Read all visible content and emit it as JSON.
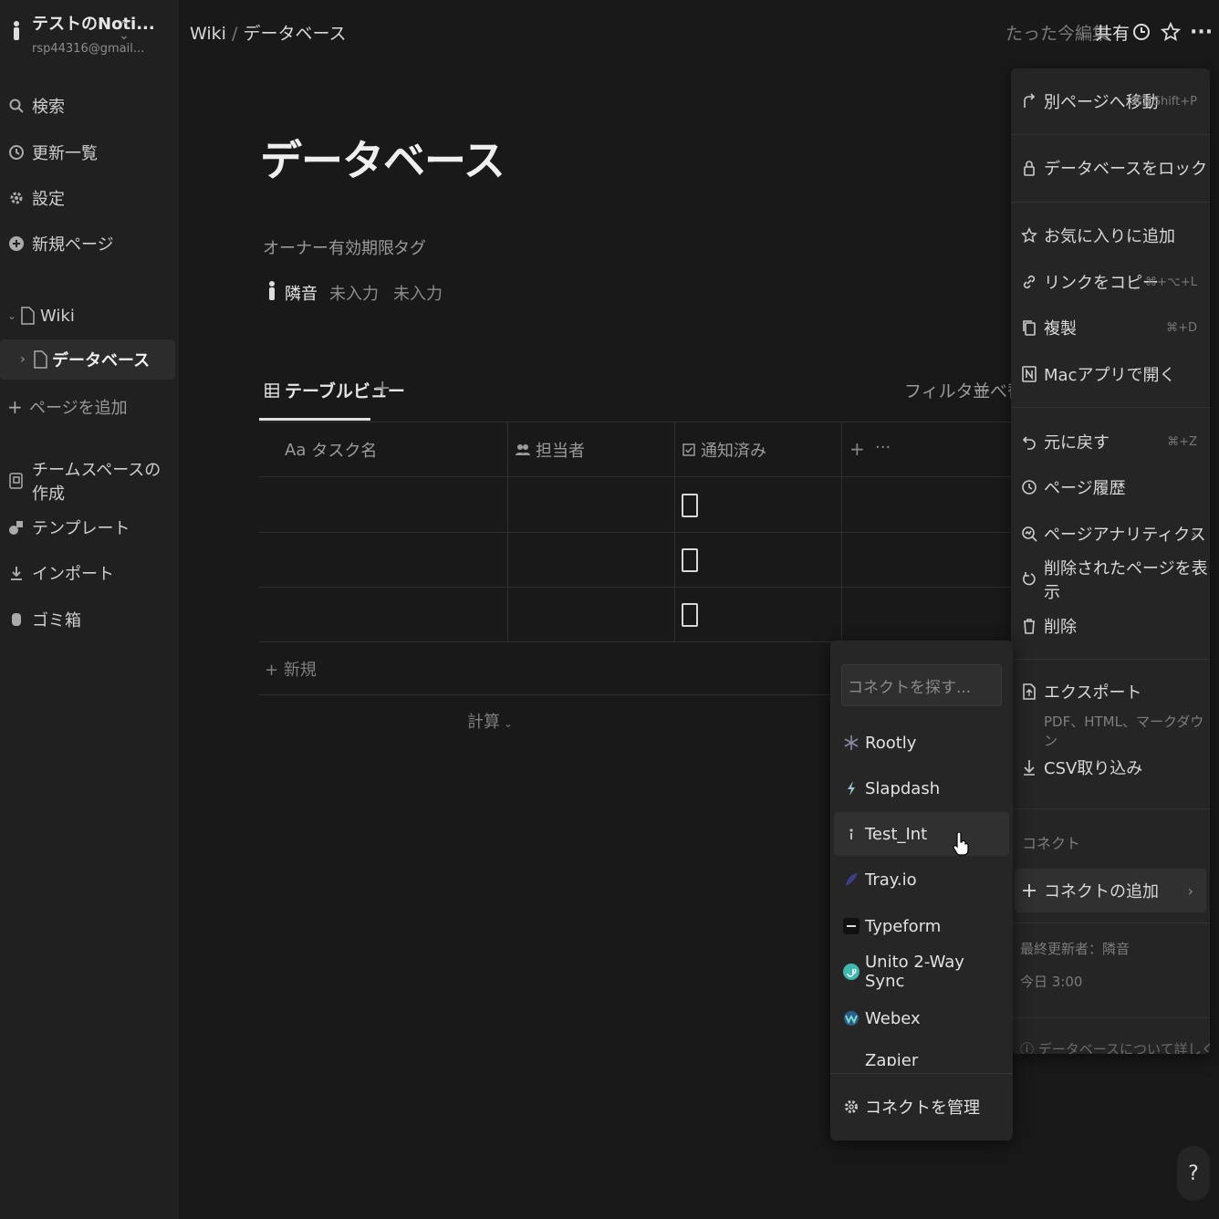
{
  "sidebar": {
    "workspace_name": "テストのNoti...",
    "workspace_email": "rsp44316@gmail...",
    "nav": [
      {
        "label": "検索",
        "icon": "search-icon"
      },
      {
        "label": "更新一覧",
        "icon": "clock-icon"
      },
      {
        "label": "設定",
        "icon": "gear-icon"
      },
      {
        "label": "新規ページ",
        "icon": "plus-circle-icon"
      }
    ],
    "tree": {
      "wiki": "Wiki",
      "database": "データベース",
      "add_page": "ページを追加"
    },
    "bottom": [
      {
        "label": "チームスペースの作成",
        "icon": "teamspace-icon"
      },
      {
        "label": "テンプレート",
        "icon": "template-icon"
      },
      {
        "label": "インポート",
        "icon": "import-icon"
      },
      {
        "label": "ゴミ箱",
        "icon": "trash-icon"
      }
    ]
  },
  "topbar": {
    "breadcrumb_parent": "Wiki",
    "breadcrumb_sep": "/",
    "breadcrumb_current": "データベース",
    "edited": "たった今編集",
    "share": "共有"
  },
  "page": {
    "title": "データベース",
    "props": {
      "owner_label": "オーナー",
      "due_label": "有効期限",
      "tag_label": "タグ",
      "owner_value": "隣音",
      "due_value": "未入力",
      "tag_value": "未入力"
    },
    "view_tab": "テーブルビュー",
    "add_view": "+",
    "filter": "フィルター",
    "sort": "並べ替",
    "columns": [
      {
        "label": "タスク名",
        "prefix": "Aa"
      },
      {
        "label": "担当者"
      },
      {
        "label": "通知済み"
      }
    ],
    "add_col": "+",
    "more_col": "···",
    "rows": [
      {
        "checked": false
      },
      {
        "checked": false
      },
      {
        "checked": false
      }
    ],
    "new_row": "新規",
    "calc": "計算"
  },
  "menu": {
    "items": [
      {
        "label": "別ページへ移動",
        "shortcut": "⌘+Shift+P",
        "icon": "move-arrow-icon"
      },
      {
        "label": "データベースをロック",
        "icon": "lock-icon"
      },
      {
        "label": "お気に入りに追加",
        "icon": "star-icon"
      },
      {
        "label": "リンクをコピー",
        "shortcut": "⌘+⌥+L",
        "icon": "link-icon"
      },
      {
        "label": "複製",
        "shortcut": "⌘+D",
        "icon": "duplicate-icon"
      },
      {
        "label": "Macアプリで開く",
        "icon": "notion-icon"
      },
      {
        "label": "元に戻す",
        "shortcut": "⌘+Z",
        "icon": "undo-icon"
      },
      {
        "label": "ページ履歴",
        "icon": "history-icon"
      },
      {
        "label": "ページアナリティクス",
        "icon": "analytics-icon"
      },
      {
        "label": "削除されたページを表示",
        "icon": "restore-icon"
      },
      {
        "label": "削除",
        "icon": "trash-icon"
      },
      {
        "label": "エクスポート",
        "icon": "export-icon"
      },
      {
        "label": "CSV取り込み",
        "icon": "download-icon"
      }
    ],
    "export_sub": "PDF、HTML、マークダウン",
    "connect_header": "コネクト",
    "add_connect": "コネクトの追加",
    "last_editor": "最終更新者：隣音",
    "last_time": "今日 3:00",
    "learn_more": "データベースについて詳しくは"
  },
  "connect_popup": {
    "search_placeholder": "コネクトを探す...",
    "items": [
      {
        "name": "Rootly",
        "color": "#6b6b8a"
      },
      {
        "name": "Slapdash",
        "color": "#7c9fb0"
      },
      {
        "name": "Test_Int",
        "color": "#9a9a9a"
      },
      {
        "name": "Tray.io",
        "color": "#3b3f8a"
      },
      {
        "name": "Typeform",
        "color": "#262626"
      },
      {
        "name": "Unito 2-Way Sync",
        "color": "#3fb8b0"
      },
      {
        "name": "Webex",
        "color": "#4fa8d8"
      },
      {
        "name": "Zapier",
        "color": "#ff4a00"
      }
    ],
    "manage": "コネクトを管理"
  },
  "help": "?"
}
